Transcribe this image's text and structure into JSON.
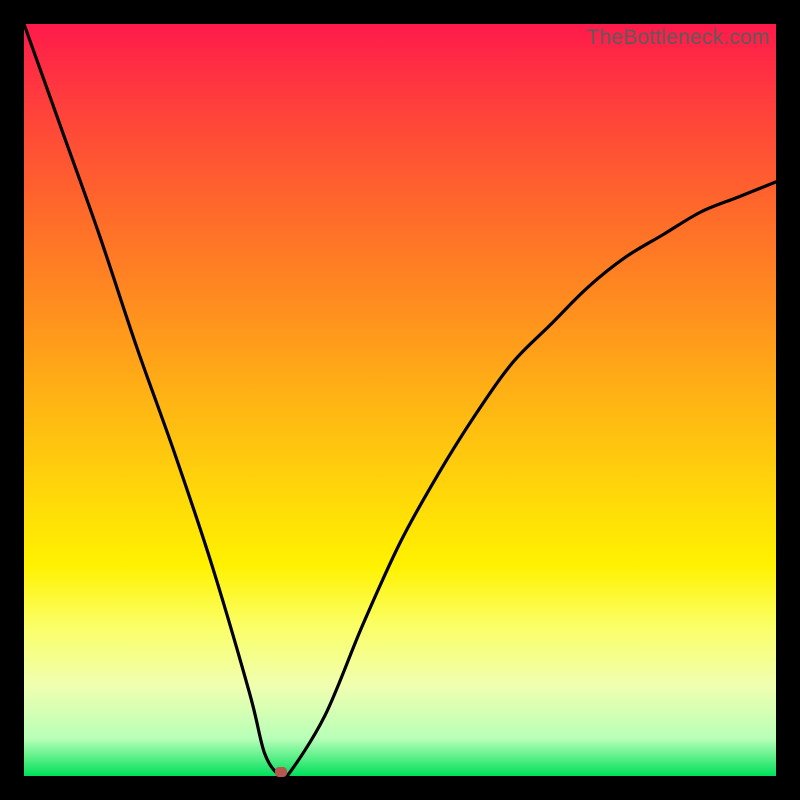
{
  "watermark": "TheBottleneck.com",
  "chart_data": {
    "type": "line",
    "title": "",
    "xlabel": "",
    "ylabel": "",
    "xlim": [
      0,
      100
    ],
    "ylim": [
      0,
      100
    ],
    "series": [
      {
        "name": "bottleneck-curve",
        "x": [
          0,
          5,
          10,
          15,
          20,
          25,
          30,
          32,
          34,
          35,
          40,
          45,
          50,
          55,
          60,
          65,
          70,
          75,
          80,
          85,
          90,
          95,
          100
        ],
        "values": [
          100,
          86,
          72,
          57,
          43,
          28,
          11,
          3,
          0,
          0,
          8,
          20,
          31,
          40,
          48,
          55,
          60,
          65,
          69,
          72,
          75,
          77,
          79
        ]
      }
    ],
    "marker": {
      "x": 34.2,
      "y": 0.5
    },
    "gradient_stops": [
      {
        "pct": 0,
        "color": "#ff1a4b"
      },
      {
        "pct": 25,
        "color": "#ff6a2a"
      },
      {
        "pct": 50,
        "color": "#ffb414"
      },
      {
        "pct": 72,
        "color": "#fff200"
      },
      {
        "pct": 100,
        "color": "#00e05a"
      }
    ]
  }
}
